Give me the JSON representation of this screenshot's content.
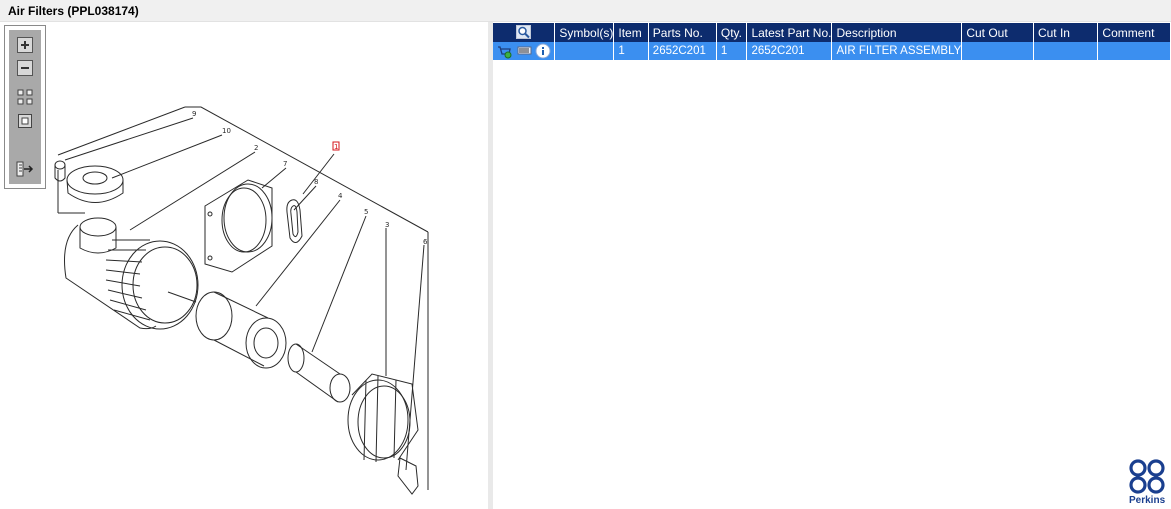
{
  "window": {
    "title": "Air Filters (PPL038174)"
  },
  "toolbar": {
    "buttons": [
      {
        "name": "zoom-in",
        "icon": "plus-icon"
      },
      {
        "name": "zoom-out",
        "icon": "minus-icon"
      },
      {
        "name": "fit-all",
        "icon": "grid-icon"
      },
      {
        "name": "actual-size",
        "icon": "square-icon"
      },
      {
        "name": "export",
        "icon": "export-icon"
      }
    ]
  },
  "diagram": {
    "callouts": [
      "9",
      "10",
      "2",
      "7",
      "1",
      "8",
      "4",
      "5",
      "3",
      "6"
    ],
    "highlighted_callout": "1",
    "highlight_color": "#d4151b"
  },
  "grid": {
    "header_color": "#0d2c6e",
    "selected_row_color": "#3b8ff0",
    "columns": [
      "",
      "Symbol(s)",
      "Item",
      "Parts No.",
      "Qty.",
      "Latest Part No.",
      "Description",
      "Cut Out",
      "Cut In",
      "Comment"
    ],
    "rows": [
      {
        "symbols": "",
        "item": "1",
        "parts_no": "2652C201",
        "qty": "1",
        "latest_part_no": "2652C201",
        "description": "AIR FILTER ASSEMBLY",
        "cut_out": "",
        "cut_in": "",
        "comment": ""
      }
    ]
  },
  "brand": {
    "name": "Perkins",
    "color": "#1a3f8f"
  }
}
